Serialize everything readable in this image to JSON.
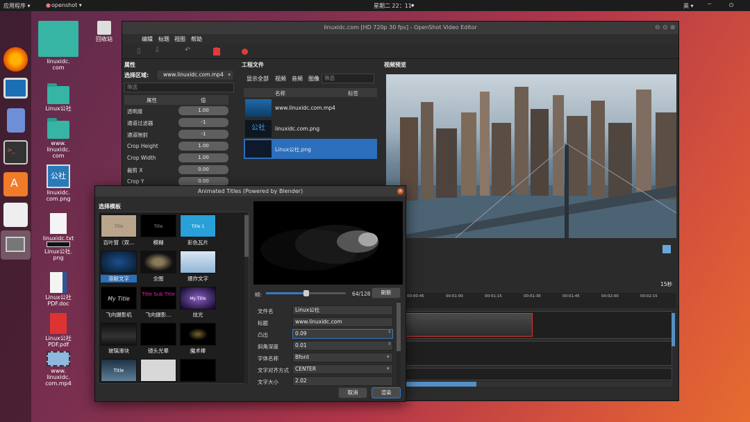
{
  "topbar": {
    "apps": "应用程序 ▾",
    "app": "openshot ▾",
    "clock": "星期二 22：11",
    "lang": "英 ▾"
  },
  "desktop": {
    "items": [
      {
        "label": "linuxidc.\ncom"
      },
      {
        "label": "Linux公社"
      },
      {
        "label": "www.\nlinuxidc.\ncom"
      },
      {
        "label": "linuxidc.\ncom.png"
      },
      {
        "label": "linuxidc.txt"
      },
      {
        "label": "Linux公社.\npng"
      },
      {
        "label": "Linux公社\nPDF.doc"
      },
      {
        "label": "Linux公社\nPDF.pdf"
      },
      {
        "label": "www.\nlinuxidc.\ncom.mp4"
      },
      {
        "label": "回收站"
      }
    ]
  },
  "window": {
    "title": "linuxidc.com [HD 720p 30 fps] - OpenShot Video Editor",
    "menu": [
      "编辑",
      "标题",
      "视图",
      "帮助"
    ]
  },
  "properties": {
    "title": "属性",
    "select_label": "选择区域:",
    "select_value": "www.linuxidc.com.mp4",
    "filter_placeholder": "筛选",
    "col_prop": "属性",
    "col_val": "值",
    "rows": [
      {
        "name": "透明度",
        "value": "1.00"
      },
      {
        "name": "通道过滤器",
        "value": "-1"
      },
      {
        "name": "通道映射",
        "value": "-1"
      },
      {
        "name": "Crop Height",
        "value": "1.00"
      },
      {
        "name": "Crop Width",
        "value": "1.00"
      },
      {
        "name": "裁剪 X",
        "value": "0.00"
      },
      {
        "name": "Crop Y",
        "value": "0.00"
      }
    ]
  },
  "project_files": {
    "title": "工程文件",
    "tabs": [
      "显示全部",
      "视频",
      "音频",
      "图像"
    ],
    "filter_placeholder": "筛选",
    "col_name": "名称",
    "col_tag": "标签",
    "files": [
      {
        "name": "www.linuxidc.com.mp4"
      },
      {
        "name": "linuxidc.com.png"
      },
      {
        "name": "Linux公社.png"
      }
    ]
  },
  "preview": {
    "title": "视频预览",
    "duration": "15秒"
  },
  "timeline": {
    "ticks": [
      "00:00:45",
      "00:01:00",
      "00:01:15",
      "00:01:30",
      "00:01:45",
      "00:02:00",
      "00:02:15"
    ]
  },
  "dialog": {
    "title": "Animated Titles (Powered by Blender)",
    "choose": "选择模板",
    "templates": [
      {
        "label": "百叶窗（双…",
        "thumb": "Title"
      },
      {
        "label": "模糊",
        "thumb": "Title"
      },
      {
        "label": "彩色瓦片",
        "thumb": "Title 1"
      },
      {
        "label": "溶解文字",
        "thumb": ""
      },
      {
        "label": "全图",
        "thumb": ""
      },
      {
        "label": "爆炸文字",
        "thumb": ""
      },
      {
        "label": "飞向摄影机",
        "thumb": "My Title"
      },
      {
        "label": "飞向摄影…",
        "thumb": "Title Sub Title"
      },
      {
        "label": "炫光",
        "thumb": "My Title"
      },
      {
        "label": "玻璃滑块",
        "thumb": ""
      },
      {
        "label": "镜头光晕",
        "thumb": ""
      },
      {
        "label": "魔术棒",
        "thumb": ""
      },
      {
        "label": "",
        "thumb": "Title"
      },
      {
        "label": "",
        "thumb": ""
      },
      {
        "label": "",
        "thumb": ""
      }
    ],
    "frame_label": "帧:",
    "frame_value": "64/128",
    "frame_progress": 0.5,
    "refresh": "刷新",
    "fields": [
      {
        "key": "文件名",
        "value": "Linux公社"
      },
      {
        "key": "标题",
        "value": "www.linuxidc.com"
      },
      {
        "key": "凸出",
        "value": "0.09"
      },
      {
        "key": "斜角深度",
        "value": "0.01"
      },
      {
        "key": "字体名称",
        "value": "Bfont"
      },
      {
        "key": "文字对齐方式",
        "value": "CENTER"
      },
      {
        "key": "文字大小",
        "value": "2.02"
      }
    ],
    "cancel": "取消",
    "render": "渲染"
  }
}
